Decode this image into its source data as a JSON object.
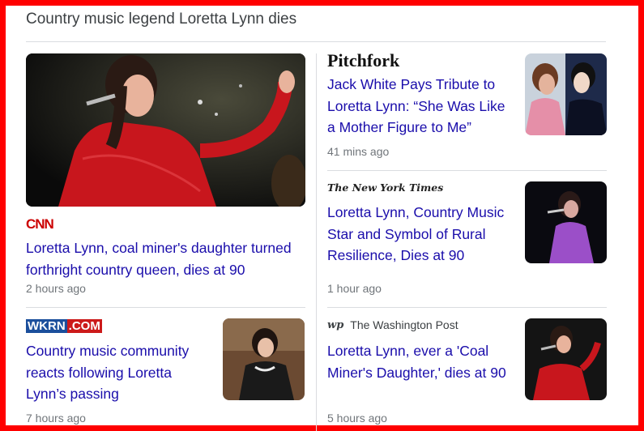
{
  "heading": "Country music legend Loretta Lynn dies",
  "articles": [
    {
      "publisher": "CNN",
      "title_lines": [
        "Loretta Lynn, coal miner's daughter turned",
        "forthright country queen, dies at 90"
      ],
      "time": "2 hours ago"
    },
    {
      "publisher": "Pitchfork",
      "title_lines": [
        "Jack White Pays Tribute to",
        "Loretta Lynn: “She Was Like",
        "a Mother Figure to Me”"
      ],
      "time": "41 mins ago"
    },
    {
      "publisher": "The New York Times",
      "title_lines": [
        "Loretta Lynn, Country Music",
        "Star and Symbol of Rural",
        "Resilience, Dies at 90"
      ],
      "time": "1 hour ago"
    },
    {
      "publisher_parts": [
        "WKRN",
        ".COM"
      ],
      "title_lines": [
        "Country music community",
        "reacts following Loretta",
        "Lynn’s passing"
      ],
      "time": "7 hours ago"
    },
    {
      "publisher_mark": "wp",
      "publisher": "The Washington Post",
      "title_lines": [
        "Loretta Lynn, ever a 'Coal",
        "Miner's Daughter,' dies at 90"
      ],
      "time": "5 hours ago"
    }
  ],
  "colors": {
    "link": "#1a0dab",
    "meta": "#70757a",
    "frame": "#ff0000"
  }
}
